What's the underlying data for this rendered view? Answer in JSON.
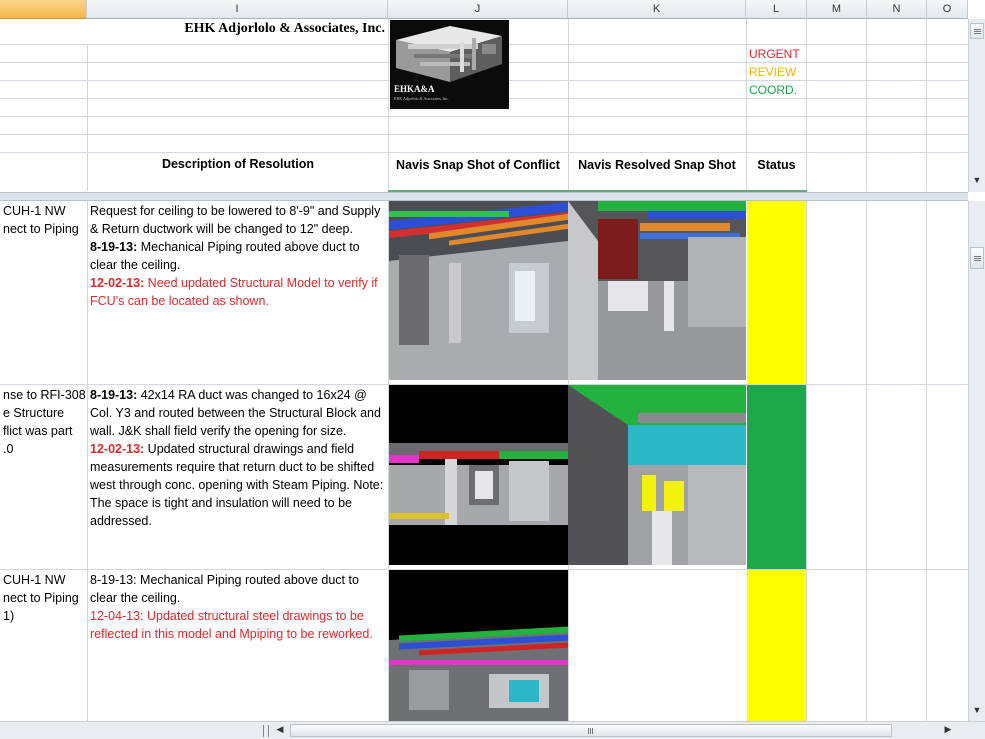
{
  "columns": [
    "",
    "I",
    "J",
    "K",
    "L",
    "M",
    "N",
    "O"
  ],
  "company_name": "EHK Adjorlolo & Associates, Inc.",
  "logo_text": {
    "main": "EHKA&A",
    "sub": "EHK Adjorlolo & Associates, Inc."
  },
  "legend": {
    "urgent": "URGENT",
    "review": "REVIEW",
    "coord": "COORD.",
    "urgent_color": "#e6262a",
    "review_color": "#f5b400",
    "coord_color": "#19a64a"
  },
  "headers": {
    "description": "Description of Resolution",
    "conflict": "Navis Snap Shot of Conflict",
    "resolved": "Navis Resolved Snap Shot",
    "status": "Status"
  },
  "rows": [
    {
      "issue_lines": [
        "CUH-1 NW",
        "nect to Piping"
      ],
      "resolution": [
        {
          "prefix": "",
          "text": "Request for ceiling to be lowered to 8'-9\" and Supply & Return ductwork will be changed to 12\" deep.",
          "red": false
        },
        {
          "prefix": "8-19-13:",
          "text": " Mechanical Piping routed above duct to clear the ceiling.",
          "red": false
        },
        {
          "prefix": "12-02-13:",
          "text": " Need updated Structural Model to verify if FCU's can be located as shown.",
          "red": true
        }
      ],
      "status_color": "#ffff00"
    },
    {
      "issue_lines": [
        "nse to RFI-308",
        "e Structure",
        "flict was part",
        ".0"
      ],
      "resolution": [
        {
          "prefix": "8-19-13:",
          "text": " 42x14 RA duct was changed to 16x24 @ Col. Y3 and routed between the Structural Block and wall.  J&K shall field verify the opening for size.",
          "red": false
        },
        {
          "prefix": "12-02-13:",
          "text": " Updated structural drawings and field measurements require that return duct to be shifted west through conc. opening with Steam Piping. Note: The space is tight and insulation will need to be addressed.",
          "red": false,
          "prefix_red": true
        }
      ],
      "status_color": "#1ea84c"
    },
    {
      "issue_lines": [
        "CUH-1 NW",
        "nect to Piping",
        "1)"
      ],
      "resolution": [
        {
          "prefix": "",
          "text": "8-19-13: Mechanical Piping routed above duct to clear the ceiling.",
          "red": false
        },
        {
          "prefix": "",
          "text": "12-04-13: Updated structural steel drawings to be reflected in this model and Mpiping to be reworked.",
          "red": true
        }
      ],
      "status_color": "#ffff00"
    }
  ],
  "icons": {
    "scroll_up": "scroll-up-arrow-icon",
    "scroll_down": "scroll-down-arrow-icon",
    "scroll_left": "scroll-left-arrow-icon",
    "scroll_right": "scroll-right-arrow-icon",
    "split": "split-box-icon"
  }
}
